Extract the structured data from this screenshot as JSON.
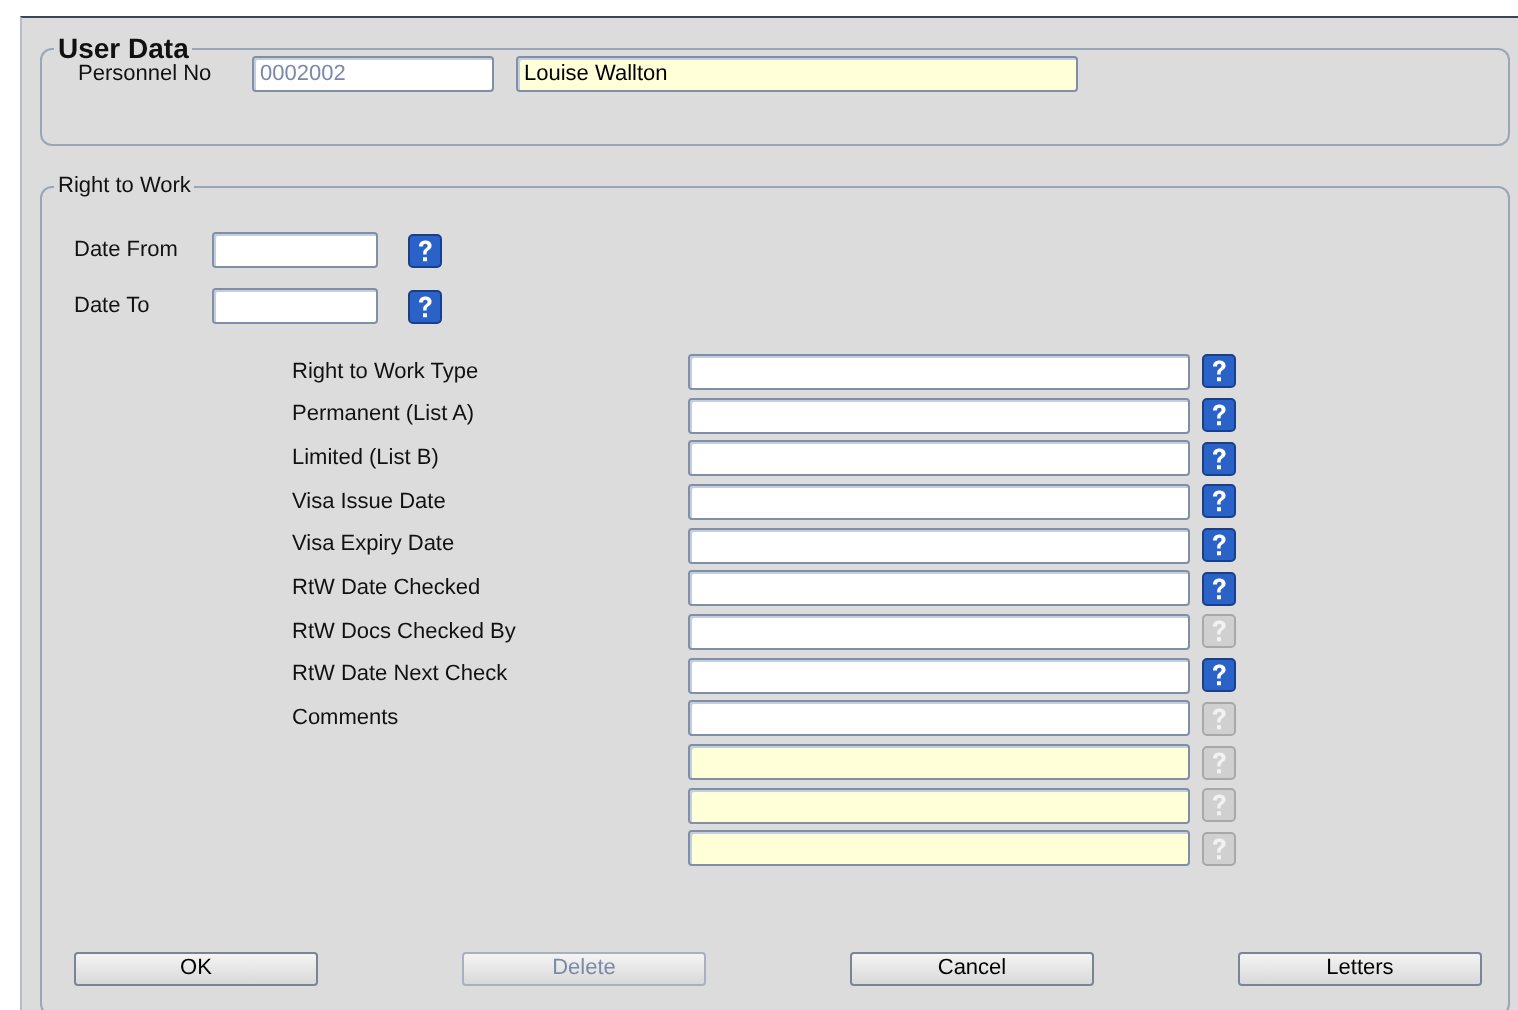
{
  "user_data": {
    "title": "User Data",
    "personnel_label": "Personnel No",
    "personnel_no": "0002002",
    "name": "Louise Wallton"
  },
  "right_to_work": {
    "title": "Right to Work",
    "dates": [
      {
        "label": "Date From",
        "help_enabled": true
      },
      {
        "label": "Date To",
        "help_enabled": true
      }
    ],
    "fields": [
      {
        "label": "Right to Work Type",
        "readonly": false,
        "help_enabled": true
      },
      {
        "label": "Permanent (List A)",
        "readonly": false,
        "help_enabled": true
      },
      {
        "label": "Limited (List B)",
        "readonly": false,
        "help_enabled": true
      },
      {
        "label": "Visa Issue Date",
        "readonly": false,
        "help_enabled": true
      },
      {
        "label": "Visa Expiry Date",
        "readonly": false,
        "help_enabled": true
      },
      {
        "label": "RtW Date Checked",
        "readonly": false,
        "help_enabled": true
      },
      {
        "label": "RtW Docs Checked By",
        "readonly": false,
        "help_enabled": false
      },
      {
        "label": "RtW Date Next Check",
        "readonly": false,
        "help_enabled": true
      },
      {
        "label": "Comments",
        "readonly": false,
        "help_enabled": false
      },
      {
        "readonly": true,
        "help_enabled": false
      },
      {
        "readonly": true,
        "help_enabled": false
      },
      {
        "readonly": true,
        "help_enabled": false
      }
    ]
  },
  "buttons": [
    {
      "label": "OK",
      "disabled": false
    },
    {
      "label": "Delete",
      "disabled": true
    },
    {
      "label": "Cancel",
      "disabled": false
    },
    {
      "label": "Letters",
      "disabled": false
    }
  ]
}
